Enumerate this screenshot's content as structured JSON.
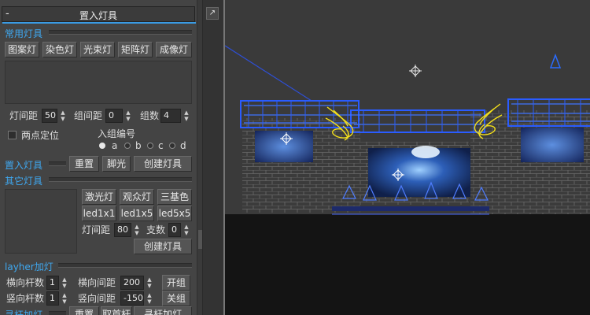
{
  "panel": {
    "collapse_symbol": "-",
    "title": "置入灯具",
    "common_section": {
      "label": "常用灯具",
      "buttons": [
        "图案灯",
        "染色灯",
        "光束灯",
        "矩阵灯",
        "成像灯"
      ],
      "spacing_label": "灯间距",
      "spacing_value": "50",
      "group_spacing_label": "组间距",
      "group_spacing_value": "0",
      "group_count_label": "组数",
      "group_count_value": "4",
      "two_point_label": "两点定位",
      "group_number_label": "入组编号",
      "radio_options": [
        "a",
        "b",
        "c",
        "d"
      ],
      "radio_selected": "a"
    },
    "place_section": {
      "label": "置入灯具",
      "reset_label": "重置",
      "foot_light_label": "脚光",
      "create_label": "创建灯具"
    },
    "other_section": {
      "label": "其它灯具",
      "buttons": [
        "激光灯",
        "观众灯",
        "三基色",
        "led1x1",
        "led1x5",
        "led5x5"
      ],
      "spacing_label": "灯间距",
      "spacing_value": "80",
      "count_label": "支数",
      "count_value": "0",
      "create_label": "创建灯具"
    },
    "layher_section": {
      "label": "layher加灯",
      "h_count_label": "横向杆数",
      "h_count_value": "1",
      "h_spacing_label": "横向间距",
      "h_spacing_value": "200",
      "v_count_label": "竖向杆数",
      "v_count_value": "1",
      "v_spacing_label": "竖向间距",
      "v_spacing_value": "-150",
      "open_group_label": "开组",
      "close_group_label": "关组"
    },
    "truss_section": {
      "label": "寻杆加灯",
      "reset_label": "重置",
      "pick_label": "取首杆",
      "find_label": "寻杆加灯"
    }
  },
  "expand_icon": "↗",
  "colors": {
    "accent": "#3fa8f0",
    "panel_bg": "#444444",
    "viewport_bg": "#3a3a3a",
    "floor": "#141414",
    "light_yellow": "#f4e01a",
    "light_blue": "#1f5cff"
  }
}
